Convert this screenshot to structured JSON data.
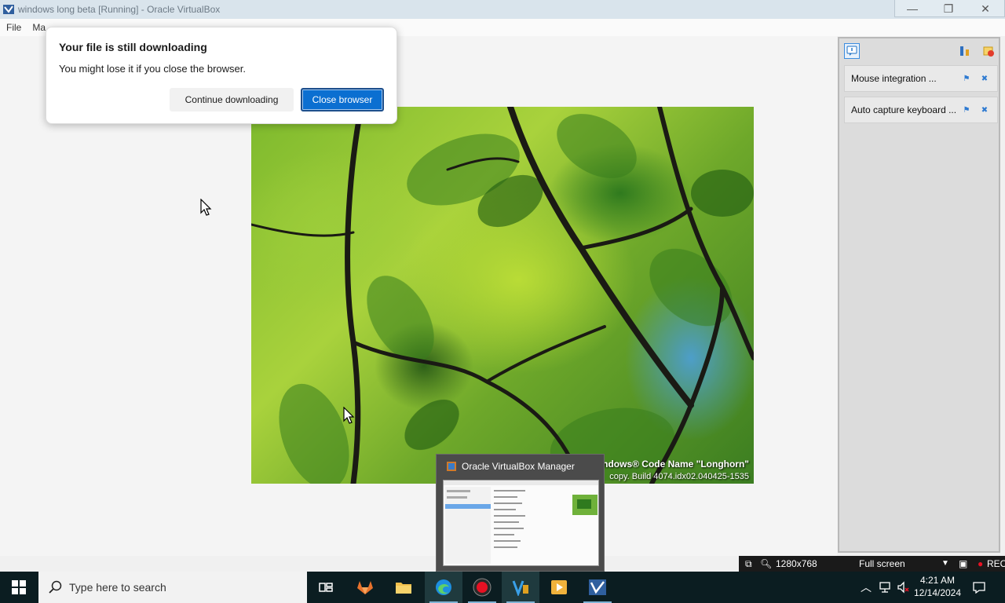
{
  "window": {
    "title": "windows long beta [Running] - Oracle VirtualBox",
    "minimize_glyph": "—",
    "maximize_glyph": "❐",
    "close_glyph": "✕"
  },
  "menu": {
    "items": [
      "File",
      "Ma"
    ]
  },
  "dialog": {
    "title": "Your file is still downloading",
    "message": "You might lose it if you close the browser.",
    "continue_label": "Continue downloading",
    "close_label": "Close browser"
  },
  "wallpaper": {
    "caption_line1": "indows® Code Name \"Longhorn\"",
    "caption_line2": "copy. Build 4074.idx02.040425-1535"
  },
  "notifications": {
    "items": [
      {
        "label": "Mouse integration ..."
      },
      {
        "label": "Auto capture keyboard ..."
      }
    ]
  },
  "statusbar": {
    "resolution": "1280x768",
    "mode": "Full screen",
    "rec": "REC"
  },
  "preview": {
    "title": "Oracle VirtualBox Manager"
  },
  "taskbar": {
    "search_placeholder": "Type here to search",
    "time": "4:21 AM",
    "date": "12/14/2024"
  },
  "colors": {
    "accent": "#0b6fd1",
    "taskbar": "#0b1d21",
    "rec": "#e81123"
  }
}
